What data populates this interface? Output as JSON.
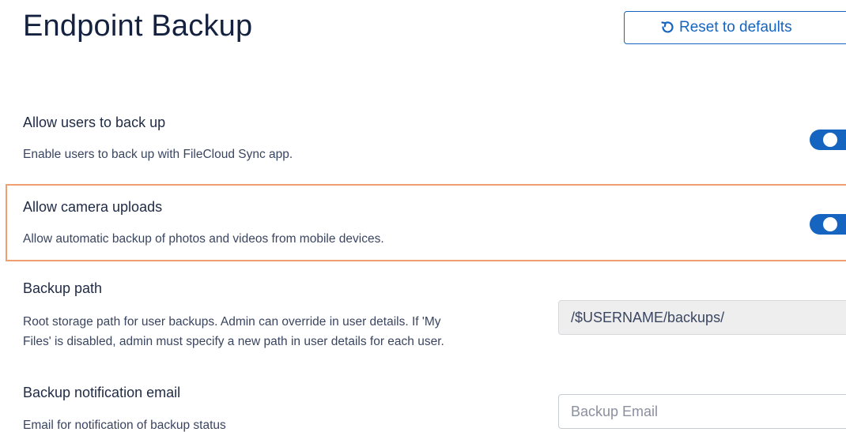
{
  "page": {
    "title": "Endpoint Backup",
    "reset_button": {
      "label": "Reset to defaults",
      "icon": "undo-icon"
    }
  },
  "settings": [
    {
      "label": "Allow users to back up",
      "description": "Enable users to back up with FileCloud Sync app.",
      "control": "toggle",
      "enabled": true
    },
    {
      "label": "Allow camera uploads",
      "description": "Allow automatic backup of photos and videos from mobile devices.",
      "control": "toggle",
      "enabled": true,
      "highlighted": true
    },
    {
      "label": "Backup path",
      "description_line1": "Root storage path for user backups. Admin can override in user details. If 'My",
      "description_line2": "Files' is disabled, admin must specify a new path in user details for each user.",
      "control": "text",
      "value": "/$USERNAME/backups/",
      "disabled": true
    },
    {
      "label": "Backup notification email",
      "description": "Email for notification of backup status",
      "control": "text",
      "value": "",
      "placeholder": "Backup Email"
    }
  ],
  "colors": {
    "accent": "#1565c0",
    "highlight_border": "#f0a070",
    "title": "#15223f"
  }
}
